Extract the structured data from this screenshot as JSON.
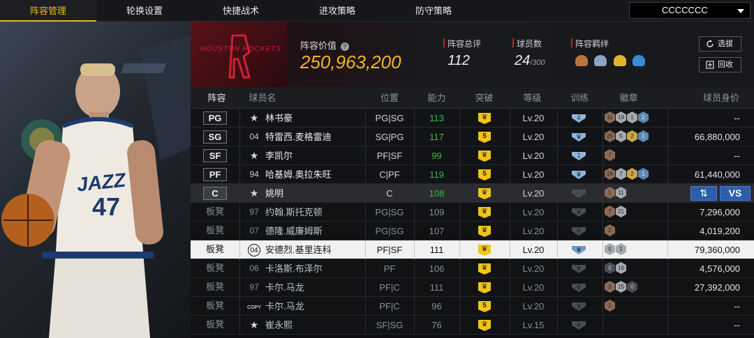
{
  "nav": {
    "tabs": [
      {
        "label": "阵容管理",
        "active": true
      },
      {
        "label": "轮换设置"
      },
      {
        "label": "快捷战术"
      },
      {
        "label": "进攻策略"
      },
      {
        "label": "防守策略"
      }
    ],
    "dropdown_value": "CCCCCCC"
  },
  "header": {
    "team_logo_text": "HOUSTON ROCKETS",
    "lineup_value_label": "阵容价值",
    "lineup_value": "250,963,200",
    "rating_label": "阵容总评",
    "rating": "112",
    "player_count_label": "球员数",
    "player_count": "24",
    "player_count_max": "/300",
    "chemistry_label": "阵容羁绊",
    "buttons": [
      {
        "label": "选拔",
        "icon": "refresh-icon"
      },
      {
        "label": "回收",
        "icon": "recycle-icon"
      }
    ],
    "colors": {
      "accent": "#f2b51c",
      "red_marker": "#c81e2c"
    }
  },
  "table": {
    "columns": [
      "阵容",
      "球员名",
      "位置",
      "能力",
      "突破",
      "等级",
      "训练",
      "徽章",
      "球员身价"
    ],
    "rows": [
      {
        "slot": "PG",
        "num": "★",
        "name": "林书豪",
        "pos": "PG|SG",
        "ability": "113",
        "break": "♛",
        "level": "Lv.20",
        "train": "4",
        "badges": [
          [
            "b",
            "11"
          ],
          [
            "s",
            "19"
          ],
          [
            "s",
            "1"
          ],
          [
            "p",
            "2"
          ]
        ],
        "value": "--"
      },
      {
        "slot": "SG",
        "num": "04",
        "name": "特雷西.麦格雷迪",
        "pos": "SG|PG",
        "ability": "117",
        "break": "5",
        "level": "Lv.20",
        "train": "♛",
        "badges": [
          [
            "b",
            "25"
          ],
          [
            "s",
            "5"
          ],
          [
            "g",
            "2"
          ],
          [
            "p",
            "1"
          ]
        ],
        "value": "66,880,000"
      },
      {
        "slot": "SF",
        "num": "★",
        "name": "李凯尔",
        "pos": "PF|SF",
        "ability": "99",
        "break": "♛",
        "level": "Lv.20",
        "train": "1",
        "badges": [
          [
            "b",
            "7"
          ]
        ],
        "value": "--"
      },
      {
        "slot": "PF",
        "num": "94",
        "name": "哈基姆.奥拉朱旺",
        "pos": "C|PF",
        "ability": "119",
        "break": "5",
        "level": "Lv.20",
        "train": "♛",
        "badges": [
          [
            "b",
            "16"
          ],
          [
            "s",
            "7"
          ],
          [
            "g",
            "2"
          ],
          [
            "p",
            "1"
          ]
        ],
        "value": "61,440,000"
      },
      {
        "slot": "C",
        "num": "★",
        "name": "姚明",
        "pos": "C",
        "ability": "108",
        "break": "♛",
        "level": "Lv.20",
        "train": "—",
        "badges": [
          [
            "b",
            "1"
          ],
          [
            "s",
            "11"
          ]
        ],
        "value": ""
      },
      {
        "slot": "板凳",
        "num": "97",
        "name": "约翰.斯托克顿",
        "pos": "PG|SG",
        "ability": "109",
        "break": "♛",
        "level": "Lv.20",
        "train": "♛",
        "badges": [
          [
            "b",
            "7"
          ],
          [
            "s",
            "21"
          ]
        ],
        "value": "7,296,000"
      },
      {
        "slot": "板凳",
        "num": "07",
        "name": "德隆.威廉姆斯",
        "pos": "PG|SG",
        "ability": "107",
        "break": "♛",
        "level": "Lv.20",
        "train": "♛",
        "badges": [
          [
            "b",
            "2"
          ]
        ],
        "value": "4,019,200"
      },
      {
        "slot": "板凳",
        "num": "04",
        "name": "安德烈.基里连科",
        "pos": "PF|SF",
        "ability": "111",
        "break": "♛",
        "level": "Lv.20",
        "train": "♛",
        "badges": [
          [
            "s",
            "0"
          ],
          [
            "s",
            "1"
          ]
        ],
        "value": "79,360,000"
      },
      {
        "slot": "板凳",
        "num": "06",
        "name": "卡洛斯.布泽尔",
        "pos": "PF",
        "ability": "106",
        "break": "♛",
        "level": "Lv.20",
        "train": "♛",
        "badges": [
          [
            "d",
            "0"
          ],
          [
            "s",
            "16"
          ]
        ],
        "value": "4,576,000"
      },
      {
        "slot": "板凳",
        "num": "97",
        "name": "卡尔.马龙",
        "pos": "PF|C",
        "ability": "111",
        "break": "♛",
        "level": "Lv.20",
        "train": "♛",
        "badges": [
          [
            "b",
            "2"
          ],
          [
            "s",
            "15"
          ],
          [
            "d",
            "0"
          ]
        ],
        "value": "27,392,000"
      },
      {
        "slot": "板凳",
        "num": "COPY",
        "name": "卡尔.马龙",
        "pos": "PF|C",
        "ability": "96",
        "break": "5",
        "level": "Lv.20",
        "train": "♛",
        "badges": [
          [
            "b",
            "1"
          ]
        ],
        "value": "--"
      },
      {
        "slot": "板凳",
        "num": "★",
        "name": "崔永熙",
        "pos": "SF|SG",
        "ability": "76",
        "break": "♛",
        "level": "Lv.15",
        "train": "♛",
        "badges": [],
        "value": "--"
      }
    ],
    "swap_label": "⇅",
    "vs_label": "VS"
  },
  "player_card": {
    "team": "JAZZ",
    "number": "47"
  }
}
